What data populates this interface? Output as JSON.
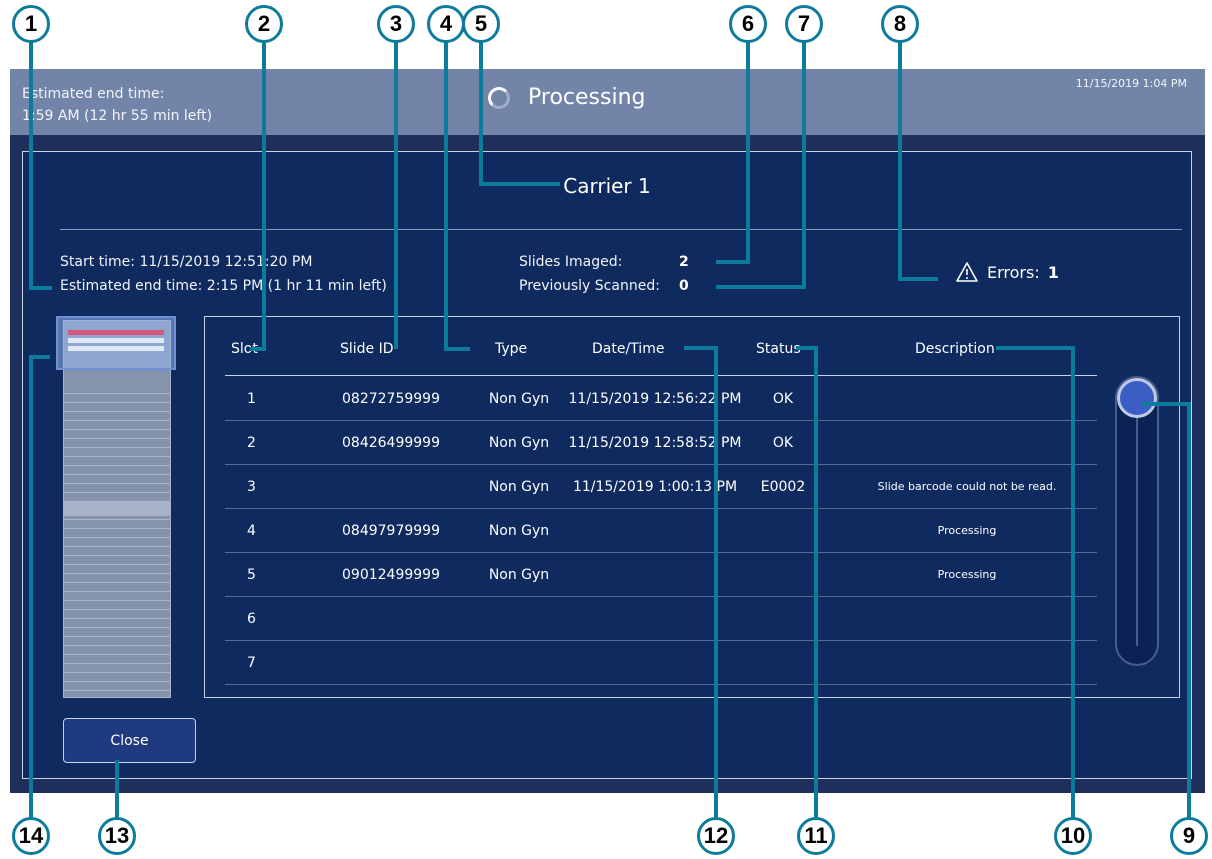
{
  "topbar": {
    "est_label": "Estimated end time:",
    "est_value": "1:59 AM (12 hr 55 min left)",
    "title": "Processing",
    "datetime": "11/15/2019 1:04 PM"
  },
  "carrier": {
    "title": "Carrier 1",
    "start_time": "Start time:  11/15/2019 12:51:20 PM",
    "est_end": "Estimated end time:  2:15 PM (1 hr 11 min left)",
    "slides_imaged_label": "Slides Imaged:",
    "slides_imaged_value": "2",
    "prev_scanned_label": "Previously Scanned:",
    "prev_scanned_value": "0",
    "errors_label": "Errors:",
    "errors_value": "1"
  },
  "table": {
    "headers": [
      "Slot",
      "Slide ID",
      "Type",
      "Date/Time",
      "Status",
      "Description"
    ],
    "rows": [
      {
        "slot": "1",
        "id": "08272759999",
        "type": "Non Gyn",
        "datetime": "11/15/2019 12:56:22 PM",
        "status": "OK",
        "desc": ""
      },
      {
        "slot": "2",
        "id": "08426499999",
        "type": "Non Gyn",
        "datetime": "11/15/2019 12:58:52 PM",
        "status": "OK",
        "desc": ""
      },
      {
        "slot": "3",
        "id": "",
        "type": "Non Gyn",
        "datetime": "11/15/2019 1:00:13 PM",
        "status": "E0002",
        "desc": "Slide barcode could not be read."
      },
      {
        "slot": "4",
        "id": "08497979999",
        "type": "Non Gyn",
        "datetime": "",
        "status": "",
        "desc": "Processing"
      },
      {
        "slot": "5",
        "id": "09012499999",
        "type": "Non Gyn",
        "datetime": "",
        "status": "",
        "desc": "Processing"
      },
      {
        "slot": "6",
        "id": "",
        "type": "",
        "datetime": "",
        "status": "",
        "desc": ""
      },
      {
        "slot": "7",
        "id": "",
        "type": "",
        "datetime": "",
        "status": "",
        "desc": ""
      }
    ]
  },
  "buttons": {
    "close": "Close"
  },
  "callouts": [
    "1",
    "2",
    "3",
    "4",
    "5",
    "6",
    "7",
    "8",
    "9",
    "10",
    "11",
    "12",
    "13",
    "14"
  ],
  "icons": {
    "spinner": "spinner-icon",
    "warning": "warning-triangle-icon"
  },
  "colors": {
    "accent": "#0d7c9c",
    "panel": "#0e2a5e",
    "topbar": "#7284a8",
    "error_slot": "#d2577a"
  }
}
